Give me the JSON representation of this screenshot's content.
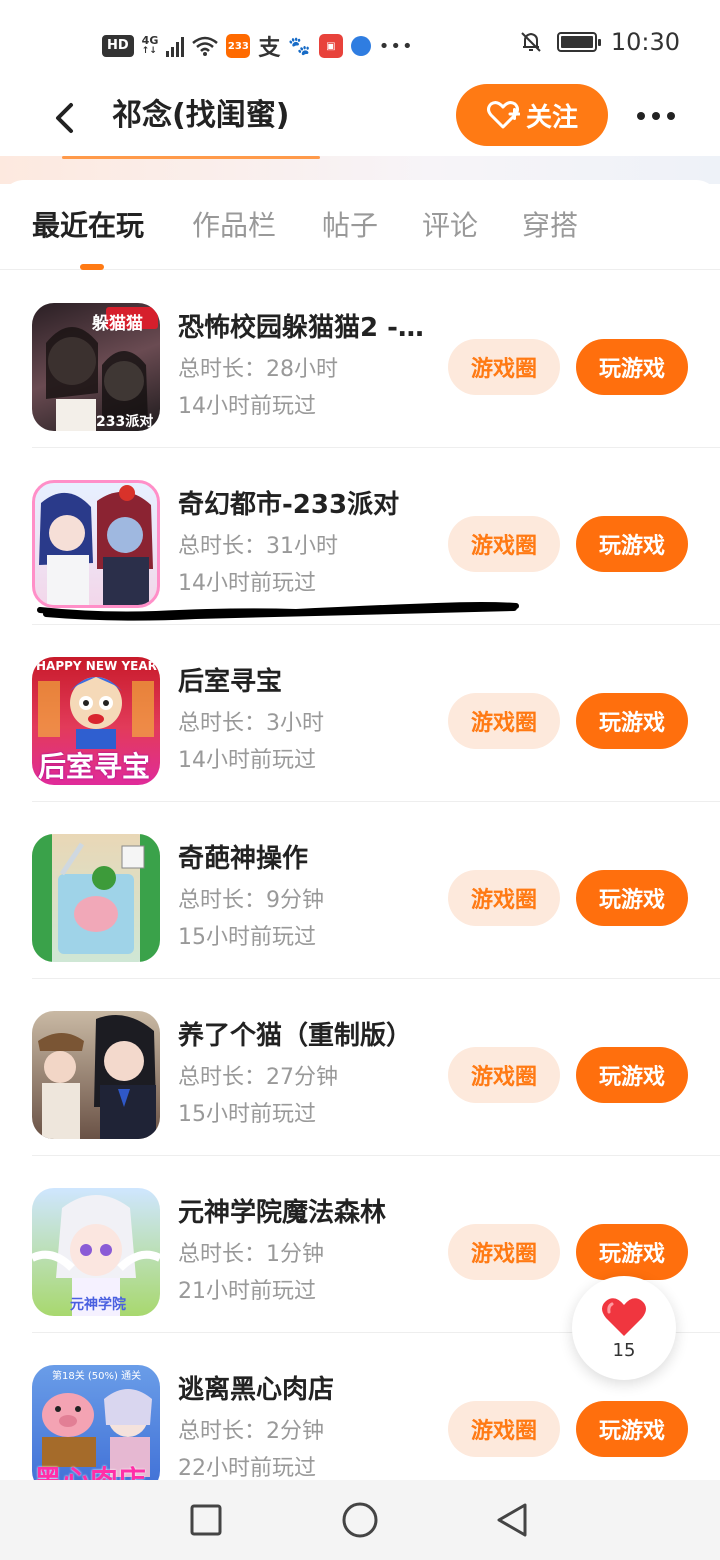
{
  "status_bar": {
    "network": "4G",
    "app_badge": "233",
    "time": "10:30"
  },
  "header": {
    "title": "祁念(找闺蜜)",
    "follow_label": "关注"
  },
  "tabs": [
    {
      "label": "最近在玩",
      "active": true
    },
    {
      "label": "作品栏",
      "active": false
    },
    {
      "label": "帖子",
      "active": false
    },
    {
      "label": "评论",
      "active": false
    },
    {
      "label": "穿搭",
      "active": false
    }
  ],
  "games": [
    {
      "name": "恐怖校园躲猫猫2 -…",
      "duration": "总时长：28小时",
      "last_played": "14小时前玩过",
      "thumb_text": "躲猫猫",
      "thumb_sub": "233派对",
      "circle_label": "游戏圈",
      "play_label": "玩游戏"
    },
    {
      "name": "奇幻都市-233派对",
      "duration": "总时长：31小时",
      "last_played": "14小时前玩过",
      "thumb_text": "",
      "thumb_sub": "",
      "circle_label": "游戏圈",
      "play_label": "玩游戏"
    },
    {
      "name": "后室寻宝",
      "duration": "总时长：3小时",
      "last_played": "14小时前玩过",
      "thumb_text": "后室寻宝",
      "thumb_sub": "HAPPY NEW YEAR",
      "circle_label": "游戏圈",
      "play_label": "玩游戏"
    },
    {
      "name": "奇葩神操作",
      "duration": "总时长：9分钟",
      "last_played": "15小时前玩过",
      "thumb_text": "",
      "thumb_sub": "",
      "circle_label": "游戏圈",
      "play_label": "玩游戏"
    },
    {
      "name": "养了个猫（重制版）",
      "duration": "总时长：27分钟",
      "last_played": "15小时前玩过",
      "thumb_text": "",
      "thumb_sub": "",
      "circle_label": "游戏圈",
      "play_label": "玩游戏"
    },
    {
      "name": "元神学院魔法森林",
      "duration": "总时长：1分钟",
      "last_played": "21小时前玩过",
      "thumb_text": "元神学院",
      "thumb_sub": "",
      "circle_label": "游戏圈",
      "play_label": "玩游戏"
    },
    {
      "name": "逃离黑心肉店",
      "duration": "总时长：2分钟",
      "last_played": "22小时前玩过",
      "thumb_text": "黑心肉店",
      "thumb_sub": "第18关 (50%) 通关",
      "circle_label": "游戏圈",
      "play_label": "玩游戏"
    }
  ],
  "like": {
    "count": "15"
  },
  "colors": {
    "accent": "#ff7a14",
    "accent_soft": "#fde9dc",
    "text_primary": "#222222",
    "text_secondary": "#999999"
  }
}
